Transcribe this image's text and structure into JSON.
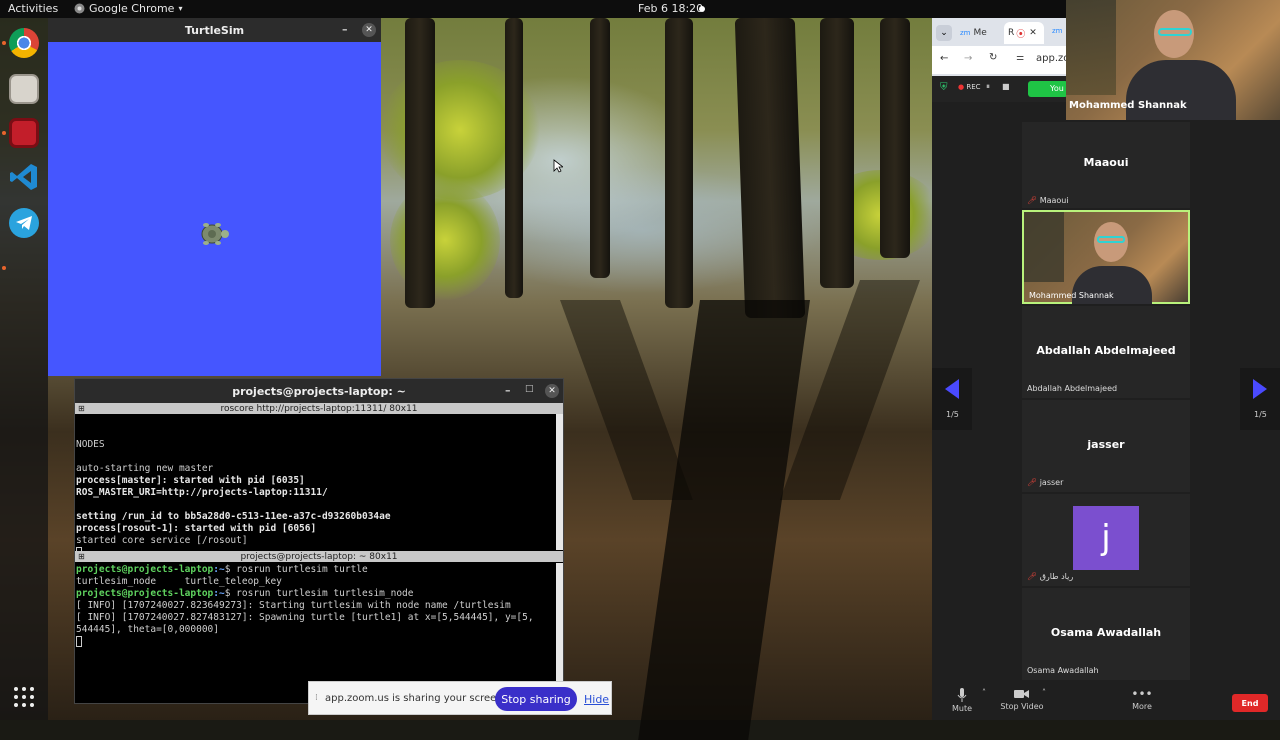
{
  "topbar": {
    "activities": "Activities",
    "app_name": "Google Chrome",
    "clock": "Feb 6  18:20"
  },
  "turtlesim": {
    "title": "TurtleSim",
    "canvas_color": "#4556ff"
  },
  "terminal": {
    "title": "projects@projects-laptop: ~",
    "pane1_title": "roscore http://projects-laptop:11311/ 80x11",
    "pane1_lines": [
      "NODES",
      "",
      "auto-starting new master",
      "process[master]: started with pid [6035]",
      "ROS_MASTER_URI=http://projects-laptop:11311/",
      "",
      "setting /run_id to bb5a28d0-c513-11ee-a37c-d93260b034ae",
      "process[rosout-1]: started with pid [6056]",
      "started core service [/rosout]"
    ],
    "pane2_title": "projects@projects-laptop: ~ 80x11",
    "prompt_user": "projects@projects-laptop",
    "prompt_path": ":~",
    "cmd1": "$ rosrun turtlesim turtle",
    "completion": "turtlesim_node     turtle_teleop_key",
    "cmd2": "$ rosrun turtlesim turtlesim_node",
    "info1": "[ INFO] [1707240027.823649273]: Starting turtlesim with node name /turtlesim",
    "info2": "[ INFO] [1707240027.827483127]: Spawning turtle [turtle1] at x=[5,544445], y=[5,",
    "info3": "544445], theta=[0,000000]"
  },
  "sharebar": {
    "message": "app.zoom.us is sharing your screen.",
    "stop_label": "Stop sharing",
    "hide_label": "Hide"
  },
  "browser": {
    "tab1": "Me",
    "tab2": "R",
    "address": "app.zoo"
  },
  "zoom": {
    "recording": "REC",
    "you_label": "You",
    "presenter_name": "Mohammed Shannak",
    "participants": [
      {
        "big": "Maaoui",
        "small": "Maaoui"
      },
      {
        "big": "",
        "small": "Mohammed Shannak"
      },
      {
        "big": "Abdallah Abdelmajeed",
        "small": "Abdallah Abdelmajeed"
      },
      {
        "big": "jasser",
        "small": "jasser"
      },
      {
        "big": "j",
        "small": "رياد طارق"
      },
      {
        "big": "Osama Awadallah",
        "small": "Osama Awadallah"
      }
    ],
    "page_left": "1/5",
    "page_right": "1/5",
    "mute_label": "Mute",
    "stop_video_label": "Stop Video",
    "more_label": "More",
    "end_label": "End"
  }
}
